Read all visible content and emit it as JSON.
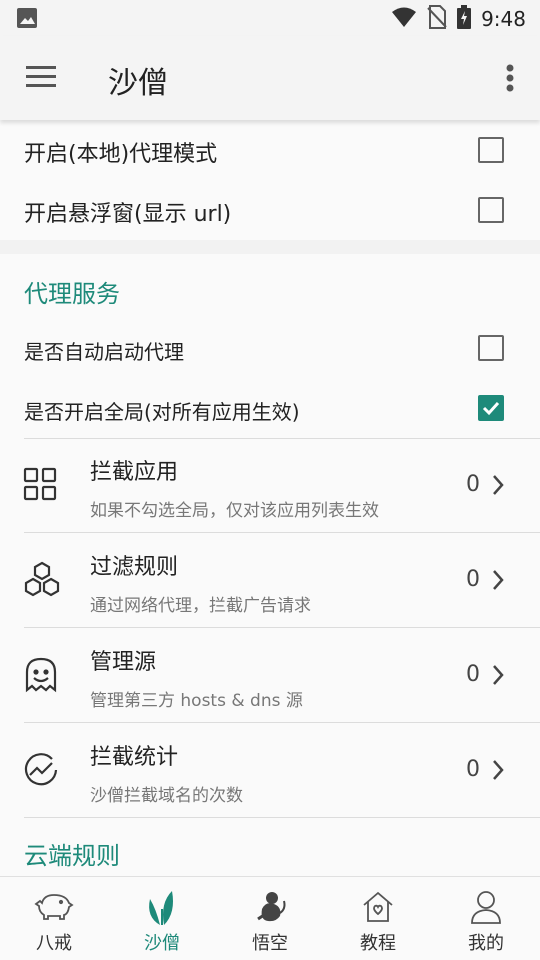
{
  "status_bar": {
    "time": "9:48"
  },
  "toolbar": {
    "title": "沙僧"
  },
  "settings": {
    "local_proxy_label": "开启(本地)代理模式",
    "local_proxy_checked": false,
    "float_window_label": "开启悬浮窗(显示 url)",
    "float_window_checked": false
  },
  "proxy_service": {
    "section_title": "代理服务",
    "auto_start_label": "是否自动启动代理",
    "auto_start_checked": false,
    "global_label": "是否开启全局(对所有应用生效)",
    "global_checked": true,
    "items": [
      {
        "title": "拦截应用",
        "subtitle": "如果不勾选全局，仅对该应用列表生效",
        "count": "0",
        "icon": "grid-icon"
      },
      {
        "title": "过滤规则",
        "subtitle": "通过网络代理，拦截广告请求",
        "count": "0",
        "icon": "hexagons-icon"
      },
      {
        "title": "管理源",
        "subtitle": "管理第三方 hosts & dns 源",
        "count": "0",
        "icon": "ghost-icon"
      },
      {
        "title": "拦截统计",
        "subtitle": "沙僧拦截域名的次数",
        "count": "0",
        "icon": "chart-icon"
      }
    ]
  },
  "cloud_rules": {
    "section_title": "云端规则"
  },
  "bottom_nav": {
    "items": [
      {
        "label": "八戒",
        "icon": "pig-icon",
        "active": false
      },
      {
        "label": "沙僧",
        "icon": "leaf-icon",
        "active": true
      },
      {
        "label": "悟空",
        "icon": "monkey-icon",
        "active": false
      },
      {
        "label": "教程",
        "icon": "home-icon",
        "active": false
      },
      {
        "label": "我的",
        "icon": "person-icon",
        "active": false
      }
    ]
  },
  "colors": {
    "accent": "#1e8a7a",
    "background": "#f2f2f2",
    "card": "#fafafa"
  }
}
